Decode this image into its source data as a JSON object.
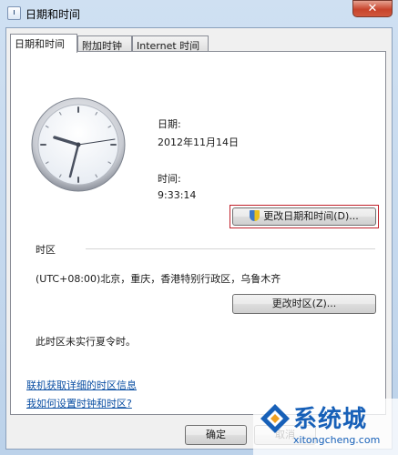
{
  "window": {
    "title": "日期和时间",
    "close_glyph": "✕"
  },
  "tabs": [
    {
      "label": "日期和时间",
      "active": true
    },
    {
      "label": "附加时钟",
      "active": false
    },
    {
      "label": "Internet 时间",
      "active": false
    }
  ],
  "datetime": {
    "date_label": "日期:",
    "date_value": "2012年11月14日",
    "time_label": "时间:",
    "time_value": "9:33:14",
    "change_button": "更改日期和时间(D)..."
  },
  "timezone": {
    "section_label": "时区",
    "value": "(UTC+08:00)北京，重庆，香港特别行政区，乌鲁木齐",
    "change_button": "更改时区(Z)...",
    "dst_note": "此时区未实行夏令时。"
  },
  "links": [
    "联机获取详细的时区信息",
    "我如何设置时钟和时区?"
  ],
  "buttons": {
    "ok": "确定",
    "cancel": "取消"
  },
  "watermark": {
    "text": "系统城",
    "url": "xitongcheng.com"
  },
  "colors": {
    "link": "#0b4fa3",
    "highlight_border": "#c0202a",
    "close_button": "#c8442c"
  }
}
